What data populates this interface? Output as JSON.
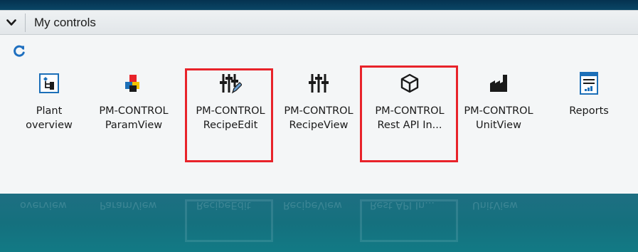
{
  "panel": {
    "title": "My controls",
    "toggle_icon": "chevron-down-icon",
    "refresh_icon": "refresh-icon"
  },
  "controls": [
    {
      "label": "Plant\noverview",
      "icon": "plant-hierarchy-icon",
      "highlighted": false
    },
    {
      "label": "PM-CONTROL\nParamView",
      "icon": "colored-blocks-icon",
      "highlighted": false
    },
    {
      "label": "PM-CONTROL\nRecipeEdit",
      "icon": "sliders-edit-icon",
      "highlighted": true
    },
    {
      "label": "PM-CONTROL\nRecipeView",
      "icon": "sliders-icon",
      "highlighted": false
    },
    {
      "label": "PM-CONTROL\nRest API In...",
      "icon": "cube-icon",
      "highlighted": true
    },
    {
      "label": "PM-CONTROL\nUnitView",
      "icon": "factory-icon",
      "highlighted": false
    },
    {
      "label": "Reports",
      "icon": "report-chart-icon",
      "highlighted": false
    }
  ],
  "colors": {
    "highlight": "#e8232a",
    "icon_dark": "#1c1c1c",
    "icon_blue": "#1e6fbf",
    "background": "#0d5a70"
  },
  "reflection_labels": [
    "overview",
    "ParamView",
    "RecipeEdit",
    "RecipeView",
    "Rest API In...",
    "UnitView"
  ]
}
